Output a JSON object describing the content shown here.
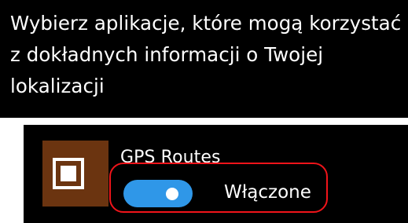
{
  "heading": {
    "text": "Wybierz aplikacje, które mogą korzystać z dokładnych informacji o Twojej lokalizacji"
  },
  "app": {
    "name": "GPS Routes",
    "icon": "app-square-icon",
    "tile_color": "#6b3410"
  },
  "toggle": {
    "state": "on",
    "label": "Włączone",
    "color": "#2f97e8"
  },
  "highlight": {
    "color": "#f0141a"
  }
}
